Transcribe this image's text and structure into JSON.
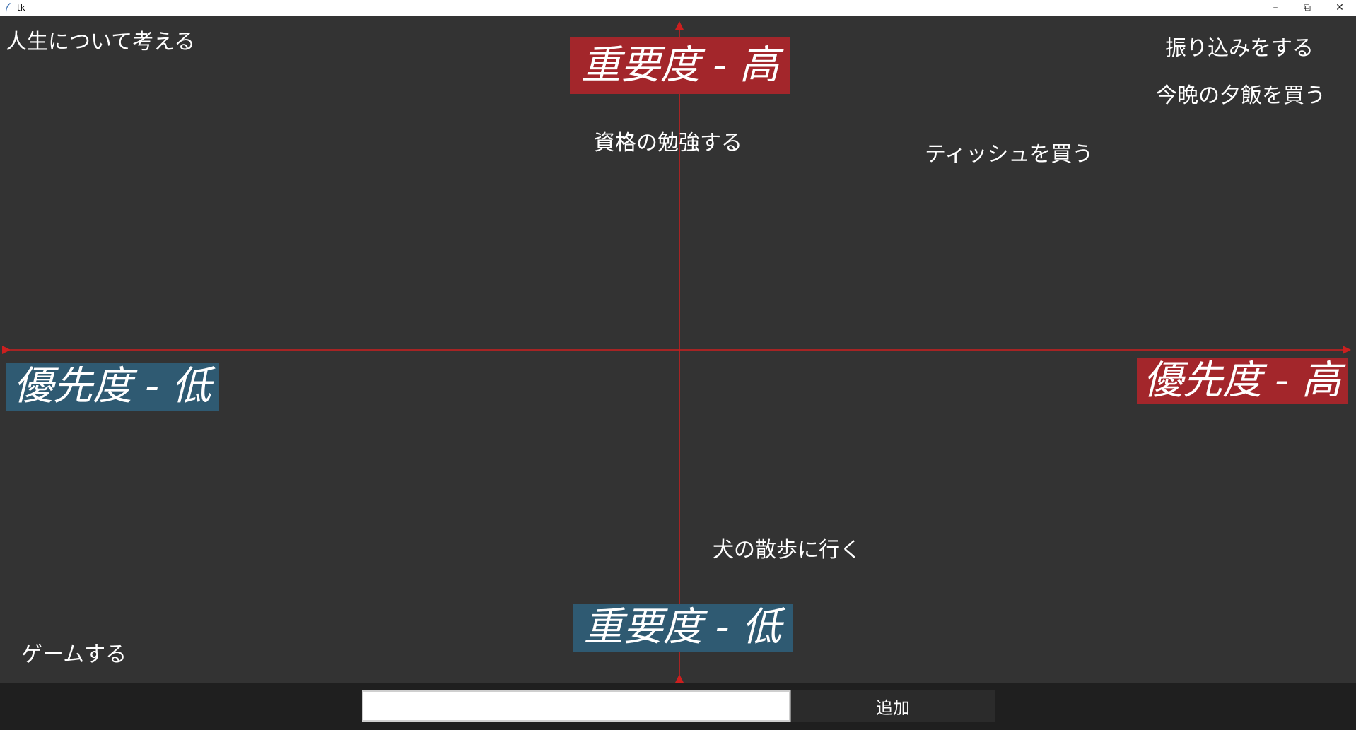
{
  "window": {
    "title": "tk",
    "app_icon": "feather-icon",
    "controls": [
      "minimize-icon",
      "maximize-icon",
      "close-icon"
    ]
  },
  "axes": {
    "color": "#cc1f1f",
    "importance_high": {
      "label": "重要度 - 高",
      "color": "#a3262b"
    },
    "importance_low": {
      "label": "重要度 - 低",
      "color": "#2f5a72"
    },
    "priority_low": {
      "label": "優先度 - 低",
      "color": "#2f5a72"
    },
    "priority_high": {
      "label": "優先度 - 高",
      "color": "#a3262b"
    }
  },
  "tasks": [
    {
      "text": "人生について考える"
    },
    {
      "text": "振り込みをする"
    },
    {
      "text": "今晩の夕飯を買う"
    },
    {
      "text": "資格の勉強する"
    },
    {
      "text": "ティッシュを買う"
    },
    {
      "text": "犬の散歩に行く"
    },
    {
      "text": "ゲームする"
    }
  ],
  "input": {
    "value": "",
    "placeholder": ""
  },
  "add_button": {
    "label": "追加"
  }
}
